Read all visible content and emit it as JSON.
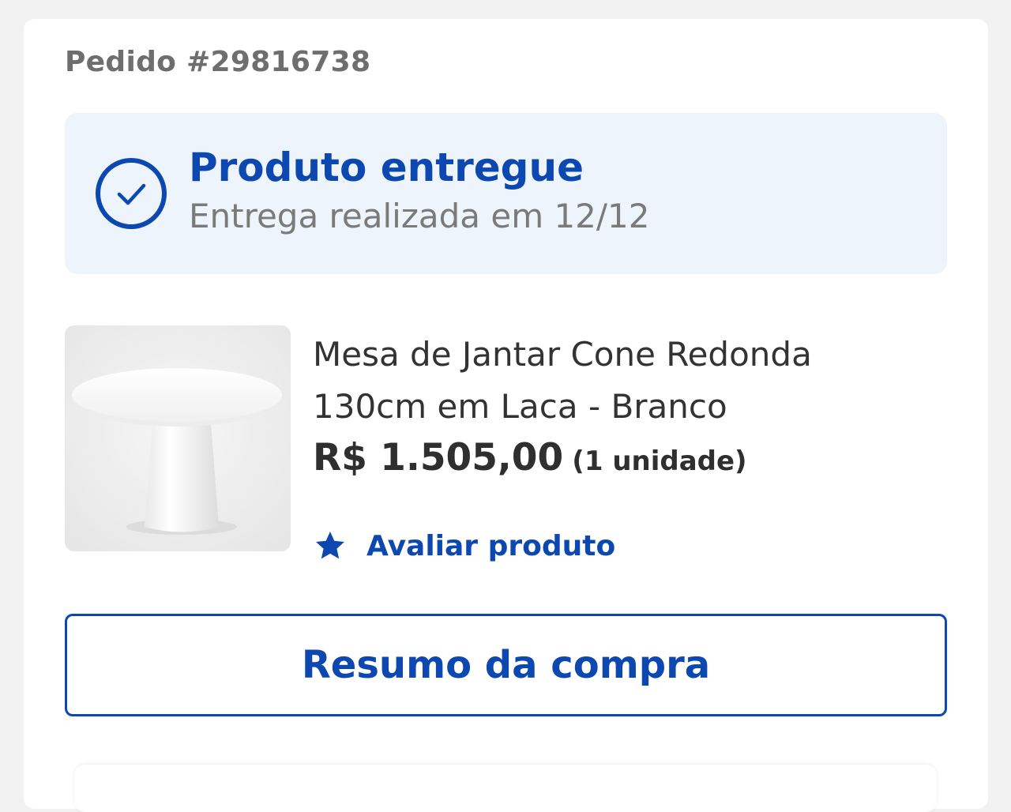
{
  "order": {
    "number_label": "Pedido #29816738"
  },
  "status": {
    "title": "Produto entregue",
    "subtitle": "Entrega realizada em 12/12",
    "icon": "check-circle-icon",
    "color": "#0d47b0",
    "background": "#eef4fc"
  },
  "product": {
    "name": "Mesa de Jantar Cone Redonda 130cm em Laca - Branco",
    "price": "R$ 1.505,00",
    "quantity": "(1 unidade)",
    "image": "round-white-cone-table"
  },
  "actions": {
    "rate_label": "Avaliar produto",
    "rate_icon": "star-icon",
    "summary_label": "Resumo da compra"
  }
}
